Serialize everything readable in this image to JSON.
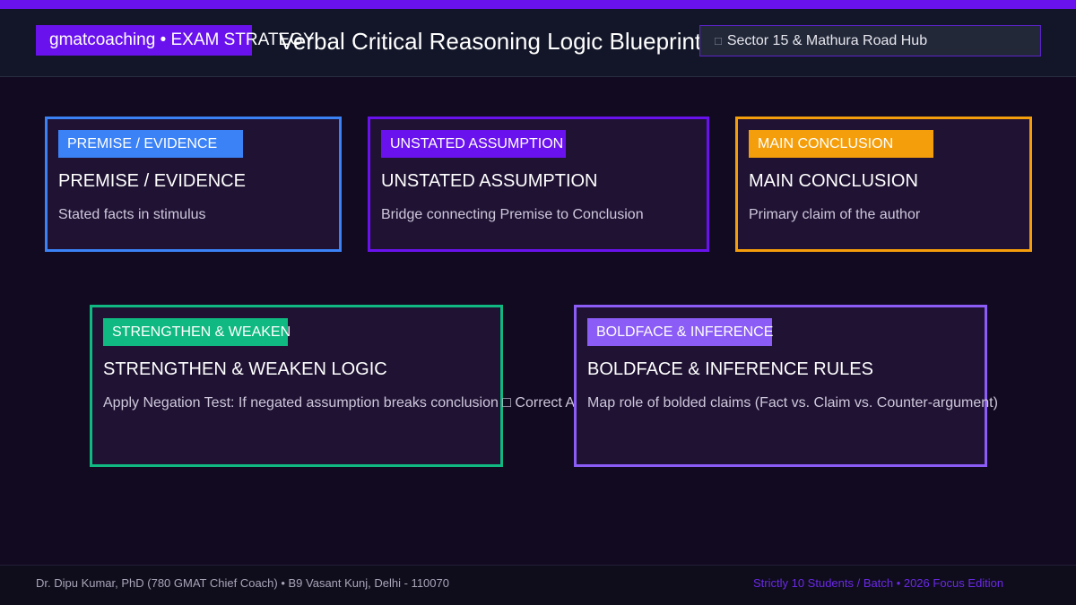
{
  "header": {
    "brand": "gmatcoaching • EXAM STRATEGY",
    "title": "Verbal Critical Reasoning Logic Blueprint",
    "location_icon": "map-pin-icon",
    "location": "Sector 15 & Mathura Road Hub"
  },
  "cards": [
    {
      "tag": "PREMISE / EVIDENCE",
      "heading": "PREMISE / EVIDENCE",
      "description": "Stated facts in stimulus",
      "color": "#3b82f6"
    },
    {
      "tag": "UNSTATED ASSUMPTION",
      "heading": "UNSTATED ASSUMPTION",
      "description": "Bridge connecting Premise to Conclusion",
      "color": "#6a12ee"
    },
    {
      "tag": "MAIN CONCLUSION",
      "heading": "MAIN CONCLUSION",
      "description": "Primary claim of the author",
      "color": "#f59e0b"
    },
    {
      "tag": "STRENGTHEN & WEAKEN",
      "heading": "STRENGTHEN & WEAKEN LOGIC",
      "description": "Apply Negation Test: If negated assumption breaks conclusion □ Correct A",
      "color": "#10b981"
    },
    {
      "tag": "BOLDFACE & INFERENCE",
      "heading": "BOLDFACE & INFERENCE RULES",
      "description": "Map role of bolded claims (Fact vs. Claim vs. Counter-argument)",
      "color": "#8b5cf6"
    }
  ],
  "footer": {
    "left": "Dr. Dipu Kumar, PhD (780 GMAT Chief Coach) • B9 Vasant Kunj, Delhi - 110070",
    "right": "Strictly 10 Students / Batch • 2026 Focus Edition"
  }
}
